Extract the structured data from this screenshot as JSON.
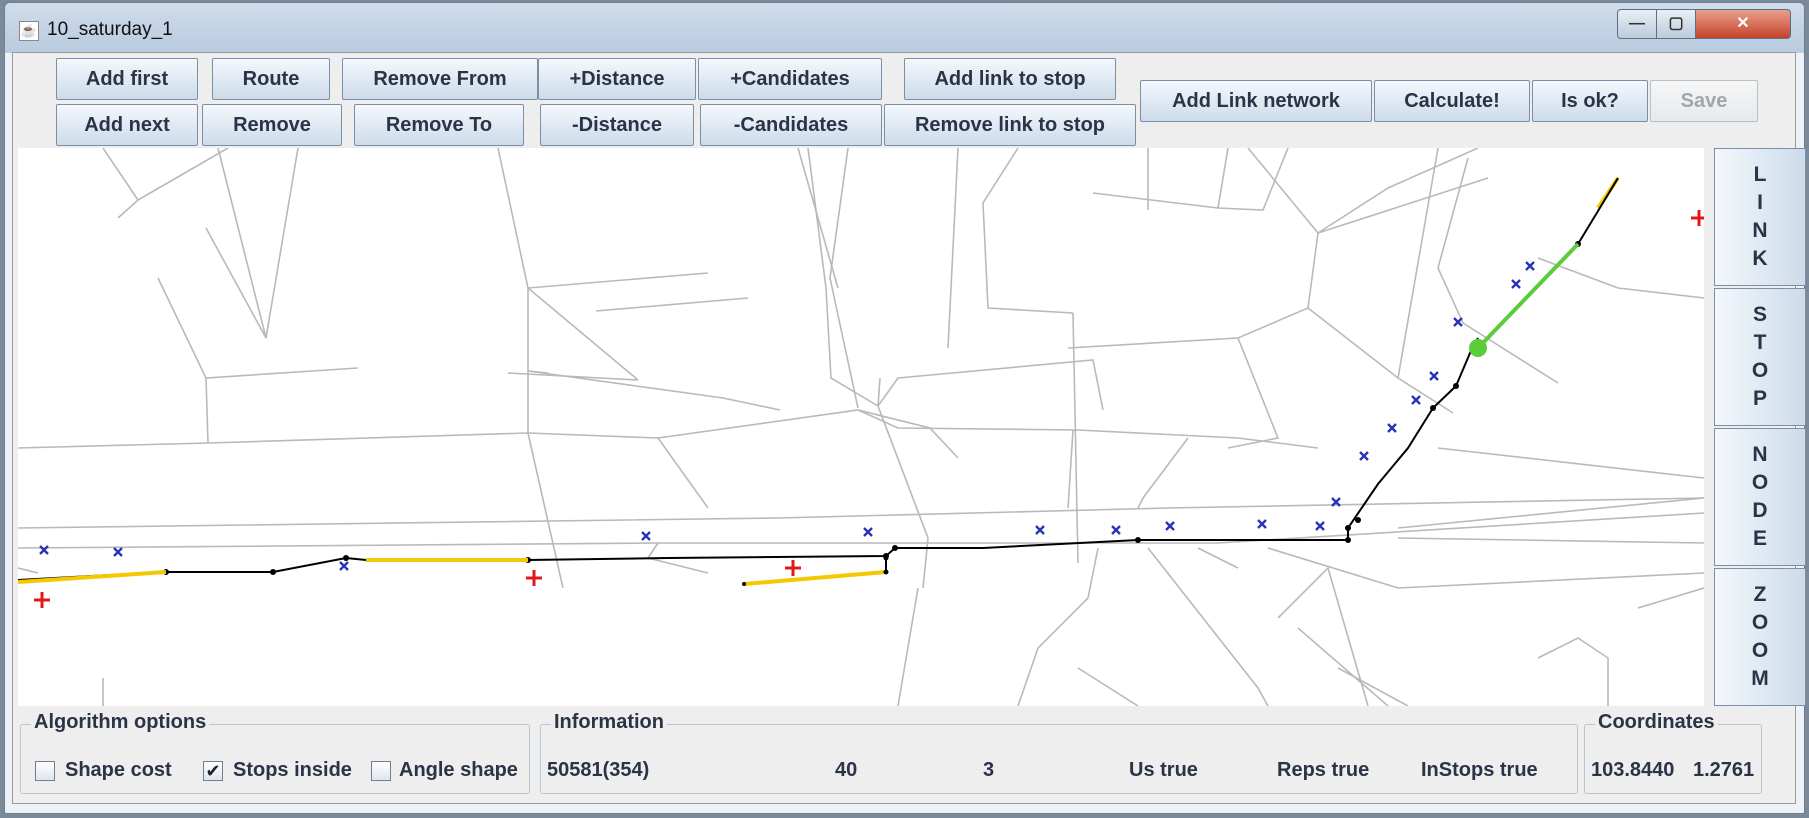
{
  "window": {
    "title": "10_saturday_1",
    "min_glyph": "—",
    "max_glyph": "▢",
    "close_glyph": "✕"
  },
  "toolbar": {
    "add_first": "Add first",
    "add_next": "Add next",
    "route": "Route",
    "remove": "Remove",
    "remove_from": "Remove From",
    "remove_to": "Remove To",
    "plus_distance": "+Distance",
    "minus_distance": "-Distance",
    "plus_candidates": "+Candidates",
    "minus_candidates": "-Candidates",
    "add_link_to_stop": "Add link to stop",
    "remove_link_to_stop": "Remove link to stop",
    "add_link_network": "Add Link network",
    "calculate": "Calculate!",
    "is_ok": "Is ok?",
    "save": "Save"
  },
  "side_buttons": {
    "link": [
      "L",
      "I",
      "N",
      "K"
    ],
    "stop": [
      "S",
      "T",
      "O",
      "P"
    ],
    "node": [
      "N",
      "O",
      "D",
      "E"
    ],
    "zoom": [
      "Z",
      "O",
      "O",
      "M"
    ]
  },
  "algorithm_options": {
    "title": "Algorithm options",
    "shape_cost": {
      "label": "Shape cost",
      "checked": false
    },
    "stops_inside": {
      "label": "Stops inside",
      "checked": true
    },
    "angle_shape": {
      "label": "Angle shape",
      "checked": false
    },
    "check_glyph": "✔"
  },
  "information": {
    "title": "Information",
    "count": "50581(354)",
    "value_a": "40",
    "value_b": "3",
    "us": "Us true",
    "reps": "Reps true",
    "instops": "InStops true"
  },
  "coordinates": {
    "title": "Coordinates",
    "lon": "103.8440",
    "lat": "1.2761"
  },
  "colors": {
    "road": "#b9b9b9",
    "route": "#000000",
    "yellow_link": "#f5c800",
    "green_link": "#5ccc3a",
    "stop_marker": "#2b34b0",
    "endpoint_marker": "#e01818"
  }
}
